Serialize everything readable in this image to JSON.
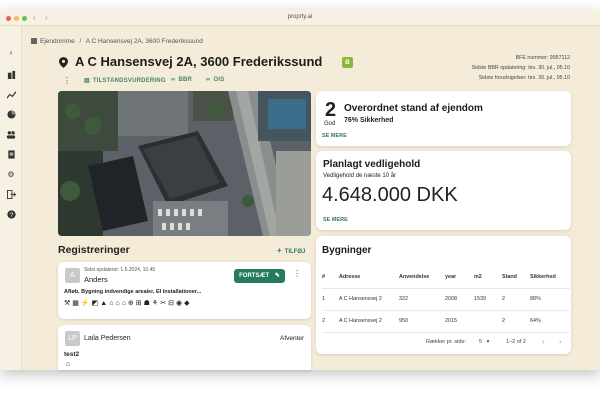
{
  "window": {
    "title": "proprty.ai"
  },
  "sidebar": {
    "icons": [
      "chevron-right-icon",
      "buildings-icon",
      "chart-icon",
      "pie-icon",
      "users-icon",
      "document-icon",
      "gear-icon",
      "logout-icon",
      "help-icon"
    ]
  },
  "breadcrumb": {
    "root": "Ejendomme",
    "separator": "/",
    "current": "A C Hansensvej 2A, 3600 Frederikssund"
  },
  "header": {
    "address": "A C Hansensvej 2A, 3600 Frederikssund",
    "badge": "B",
    "bfe": "BFE nummer: 9957112",
    "bbr_update": "Sidste BBR opdatering: tirs. 30. jul., 05.10",
    "forudsigelse": "Sidste forudsigelser: tirs. 30. jul., 05.10"
  },
  "tabs": [
    {
      "label": "TILSTANDSVURDERING"
    },
    {
      "label": "BBR"
    },
    {
      "label": "OIS"
    }
  ],
  "overall": {
    "score": "2",
    "score_label": "God",
    "title": "Overordnet stand af ejendom",
    "certainty": "76% Sikkerhed",
    "link": "SE MERE"
  },
  "maintenance": {
    "title": "Planlagt vedligehold",
    "subtitle": "Vedligehold de næste 10 år",
    "amount": "4.648.000 DKK",
    "link": "SE MERE"
  },
  "registrations": {
    "title": "Registreringer",
    "add_label": "TILFØJ",
    "items": [
      {
        "avatar": "A",
        "updated": "Sidst opdateret: 1.5.2024, 10.45",
        "name": "Anders",
        "button": "FORTSÆT",
        "description": "Afløb, Bygning indvendige arealer, El installationer..."
      },
      {
        "avatar": "LP",
        "name": "Laila Pedersen",
        "status": "Afventer",
        "text": "test2"
      }
    ]
  },
  "buildings": {
    "title": "Bygninger",
    "columns": [
      "#",
      "Adresse",
      "Anvendelse",
      "year",
      "m2",
      "Stand",
      "Sikkerhed"
    ],
    "rows": [
      [
        "1",
        "A C Hansensvej 2",
        "322",
        "2008",
        "1539",
        "2",
        "88%"
      ],
      [
        "2",
        "A C Hansensvej 2",
        "950",
        "2015",
        "",
        "2",
        "64%"
      ]
    ],
    "rows_per_page_label": "Rækker pr. side:",
    "rows_per_page": "5",
    "range": "1–2 of 2"
  },
  "colors": {
    "accent": "#2f7a5b",
    "badge": "#8bb83a",
    "background": "#f4ecd8"
  }
}
